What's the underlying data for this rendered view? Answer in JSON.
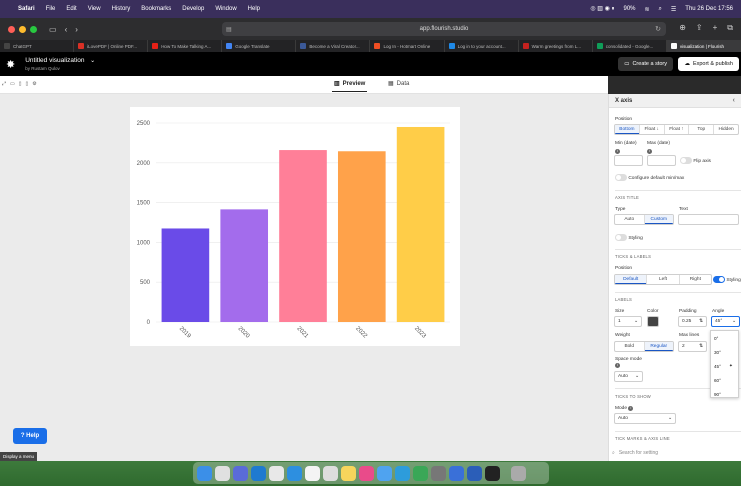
{
  "menubar": {
    "items": [
      "Safari",
      "File",
      "Edit",
      "View",
      "History",
      "Bookmarks",
      "Develop",
      "Window",
      "Help"
    ],
    "battery": "90%",
    "clock": "Thu 26 Dec  17:56"
  },
  "browser": {
    "url": "app.flourish.studio",
    "tabs": [
      {
        "label": "ChatGPT",
        "color": "#444"
      },
      {
        "label": "iLovePDF | Online PDF...",
        "color": "#d93025"
      },
      {
        "label": "How To Make Talking A...",
        "color": "#e62117"
      },
      {
        "label": "Google Translate",
        "color": "#4285f4"
      },
      {
        "label": "Become a Viral Creator...",
        "color": "#3b5998"
      },
      {
        "label": "Log In - Hotmart Online",
        "color": "#f04e23"
      },
      {
        "label": "Log in to your account...",
        "color": "#1e88e5"
      },
      {
        "label": "Warm greetings from L...",
        "color": "#c5221f"
      },
      {
        "label": "consolidated - Google...",
        "color": "#0f9d58"
      },
      {
        "label": "visualization | Flourish",
        "color": "#111"
      }
    ]
  },
  "app": {
    "doc_title": "Untitled visualization",
    "doc_sub": "by Rustam Qulov",
    "create_story": "Create a story",
    "export": "Export & publish",
    "preview_tab": "Preview",
    "data_tab": "Data",
    "help": "? Help",
    "tooltip": "Display a menu"
  },
  "chart_data": {
    "type": "bar",
    "categories": [
      "2019",
      "2020",
      "2021",
      "2022",
      "2023"
    ],
    "values": [
      1175,
      1415,
      2160,
      2145,
      2450
    ],
    "colors": [
      "#6a4be8",
      "#a36cec",
      "#ff7f98",
      "#ffa24a",
      "#ffcd48"
    ],
    "ylim": [
      0,
      2500
    ],
    "yticks": [
      "0",
      "500",
      "1000",
      "1500",
      "2000",
      "2500"
    ],
    "grid": true
  },
  "panel": {
    "header": "X axis",
    "position_label": "Position",
    "positions": [
      "Bottom",
      "Float ↓",
      "Float ↑",
      "Top",
      "Hidden"
    ],
    "min_label": "Min (date)",
    "max_label": "Max (date)",
    "flip_label": "Flip axis",
    "config_label": "Configure default min/max",
    "axis_title_sec": "AXIS TITLE",
    "type_label": "Type",
    "text_label": "Text",
    "types": [
      "Auto",
      "Custom"
    ],
    "styling_label": "Styling",
    "ticks_sec": "TICKS & LABELS",
    "tick_pos_label": "Position",
    "tick_positions": [
      "Default",
      "Left",
      "Right"
    ],
    "tick_styling": "Styling",
    "labels_sec": "LABELS",
    "size_label": "Size",
    "size_value": "1",
    "color_label": "Color",
    "padding_label": "Padding",
    "padding_value": "0.25",
    "angle_label": "Angle",
    "angle_value": "45°",
    "weight_label": "Weight",
    "weights": [
      "Bold",
      "Regular"
    ],
    "maxlines_label": "Max lines",
    "maxlines_value": "2",
    "space_label": "Space mode",
    "space_value": "Auto",
    "ticks_show_sec": "TICKS TO SHOW",
    "mode_label": "Mode",
    "mode_value": "Auto",
    "tickmarks_sec": "TICK MARKS & AXIS LINE",
    "search_placeholder": "Search for setting",
    "angle_options": [
      "0°",
      "30°",
      "45°",
      "60°",
      "90°"
    ]
  }
}
